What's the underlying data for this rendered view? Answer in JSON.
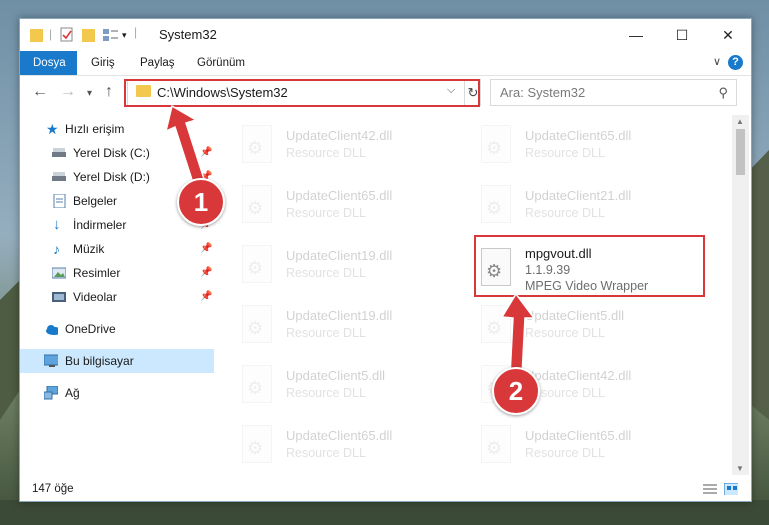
{
  "window": {
    "title": "System32",
    "minimize": "—",
    "maximize": "☐",
    "close": "✕"
  },
  "ribbon": {
    "tabs": [
      "Dosya",
      "Giriş",
      "Paylaş",
      "Görünüm"
    ],
    "help": "?",
    "collapse": "∨"
  },
  "address": {
    "path": "C:\\Windows\\System32",
    "search_placeholder": "Ara: System32"
  },
  "nav": {
    "items": [
      {
        "label": "Hızlı erişim",
        "icon": "star-icon"
      },
      {
        "label": "Yerel Disk (C:)",
        "icon": "drive-icon",
        "pinned": true
      },
      {
        "label": "Yerel Disk (D:)",
        "icon": "drive-icon",
        "pinned": true
      },
      {
        "label": "Belgeler",
        "icon": "documents-icon",
        "pinned": true
      },
      {
        "label": "İndirmeler",
        "icon": "download-icon",
        "pinned": true
      },
      {
        "label": "Müzik",
        "icon": "music-icon",
        "pinned": true
      },
      {
        "label": "Resimler",
        "icon": "pictures-icon",
        "pinned": true
      },
      {
        "label": "Videolar",
        "icon": "video-icon",
        "pinned": true
      },
      {
        "label": "OneDrive",
        "icon": "cloud-icon"
      },
      {
        "label": "Bu bilgisayar",
        "icon": "computer-icon",
        "selected": true
      },
      {
        "label": "Ağ",
        "icon": "network-icon"
      }
    ]
  },
  "files": {
    "left": [
      {
        "name": "UpdateClient42.dll",
        "sub": "Resource DLL"
      },
      {
        "name": "UpdateClient65.dll",
        "sub": "Resource DLL"
      },
      {
        "name": "UpdateClient19.dll",
        "sub": "Resource DLL"
      },
      {
        "name": "UpdateClient19.dll",
        "sub": "Resource DLL"
      },
      {
        "name": "UpdateClient5.dll",
        "sub": "Resource DLL"
      },
      {
        "name": "UpdateClient65.dll",
        "sub": "Resource DLL"
      }
    ],
    "right": [
      {
        "name": "UpdateClient65.dll",
        "sub": "Resource DLL"
      },
      {
        "name": "UpdateClient21.dll",
        "sub": "Resource DLL"
      },
      {
        "name": "mpgvout.dll",
        "sub": "1.1.9.39",
        "sub2": "MPEG Video Wrapper"
      },
      {
        "name": "UpdateClient5.dll",
        "sub": "Resource DLL"
      },
      {
        "name": "UpdateClient42.dll",
        "sub": "Resource DLL"
      },
      {
        "name": "UpdateClient65.dll",
        "sub": "Resource DLL"
      }
    ]
  },
  "status": {
    "count": "147 öğe"
  },
  "annotations": {
    "step1": "1",
    "step2": "2",
    "color": "#d9383a"
  }
}
